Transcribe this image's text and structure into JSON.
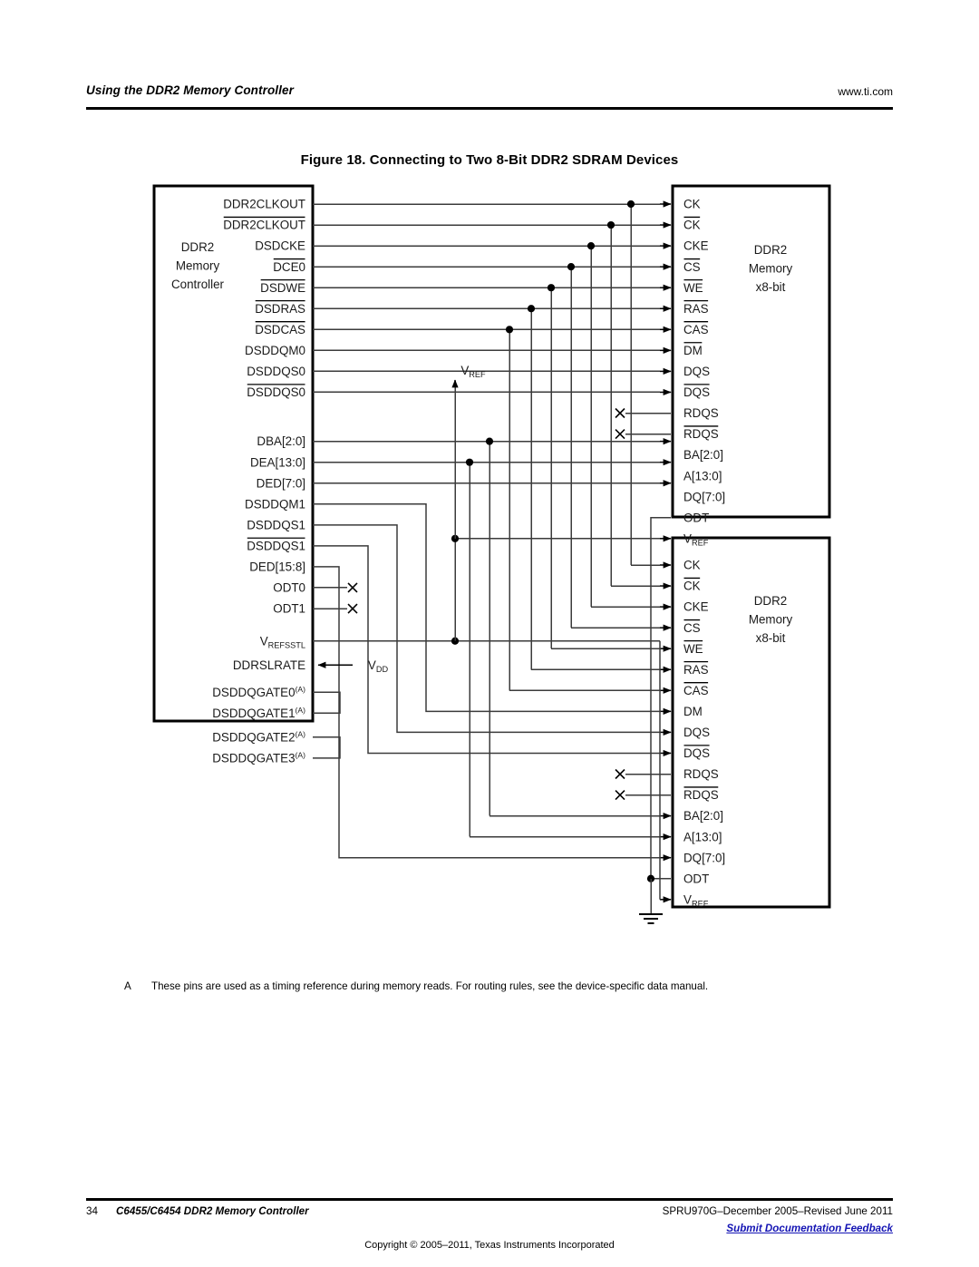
{
  "header": {
    "left_title": "Using the DDR2 Memory Controller",
    "url": "www.ti.com"
  },
  "figure": {
    "title": "Figure 18. Connecting to Two 8-Bit DDR2 SDRAM Devices"
  },
  "diagram": {
    "controller": {
      "name_line1": "DDR2",
      "name_line2": "Memory",
      "name_line3": "Controller",
      "pins": [
        {
          "label": "DDR2CLKOUT",
          "overbar": false
        },
        {
          "label": "DDR2CLKOUT",
          "overbar": true
        },
        {
          "label": "DSDCKE",
          "overbar": false
        },
        {
          "label": "DCE0",
          "overbar": true
        },
        {
          "label": "DSDWE",
          "overbar": true
        },
        {
          "label": "DSDRAS",
          "overbar": true
        },
        {
          "label": "DSDCAS",
          "overbar": true
        },
        {
          "label": "DSDDQM0",
          "overbar": false
        },
        {
          "label": "DSDDQS0",
          "overbar": false
        },
        {
          "label": "DSDDQS0",
          "overbar": true
        },
        {
          "label": "DBA[2:0]",
          "overbar": false
        },
        {
          "label": "DEA[13:0]",
          "overbar": false
        },
        {
          "label": "DED[7:0]",
          "overbar": false
        },
        {
          "label": "DSDDQM1",
          "overbar": false
        },
        {
          "label": "DSDDQS1",
          "overbar": false
        },
        {
          "label": "DSDDQS1",
          "overbar": true
        },
        {
          "label": "DED[15:8]",
          "overbar": false
        },
        {
          "label": "ODT0",
          "overbar": false
        },
        {
          "label": "ODT1",
          "overbar": false
        },
        {
          "label": "VREFSSTL",
          "overbar": false
        },
        {
          "label": "DDRSLRATE",
          "overbar": false
        },
        {
          "label": "DSDDQGATE0",
          "overbar": false
        },
        {
          "label": "DSDDQGATE1",
          "overbar": false
        },
        {
          "label": "DSDDQGATE2",
          "overbar": false
        },
        {
          "label": "DSDDQGATE3",
          "overbar": false
        }
      ],
      "vrefsstl_base": "V",
      "vrefsstl_sub": "REFSSTL",
      "gate_footnote": "(A)",
      "vdd_base": "V",
      "vdd_sub": "DD"
    },
    "memory_top": {
      "name_line1": "DDR2",
      "name_line2": "Memory",
      "name_line3": "x8-bit",
      "pins": [
        {
          "label": "CK",
          "overbar": false
        },
        {
          "label": "CK",
          "overbar": true
        },
        {
          "label": "CKE",
          "overbar": false
        },
        {
          "label": "CS",
          "overbar": true
        },
        {
          "label": "WE",
          "overbar": true
        },
        {
          "label": "RAS",
          "overbar": true
        },
        {
          "label": "CAS",
          "overbar": true
        },
        {
          "label": "DM",
          "overbar": true
        },
        {
          "label": "DQS",
          "overbar": false
        },
        {
          "label": "DQS",
          "overbar": true
        },
        {
          "label": "RDQS",
          "overbar": false
        },
        {
          "label": "RDQS",
          "overbar": true
        },
        {
          "label": "BA[2:0]",
          "overbar": false
        },
        {
          "label": "A[13:0]",
          "overbar": false
        },
        {
          "label": "DQ[7:0]",
          "overbar": false
        },
        {
          "label": "ODT",
          "overbar": false
        },
        {
          "label": "VREF",
          "overbar": false
        }
      ]
    },
    "memory_bottom": {
      "name_line1": "DDR2",
      "name_line2": "Memory",
      "name_line3": "x8-bit",
      "pins": [
        {
          "label": "CK",
          "overbar": false
        },
        {
          "label": "CK",
          "overbar": true
        },
        {
          "label": "CKE",
          "overbar": false
        },
        {
          "label": "CS",
          "overbar": true
        },
        {
          "label": "WE",
          "overbar": true
        },
        {
          "label": "RAS",
          "overbar": true
        },
        {
          "label": "CAS",
          "overbar": true
        },
        {
          "label": "DM",
          "overbar": false
        },
        {
          "label": "DQS",
          "overbar": false
        },
        {
          "label": "DQS",
          "overbar": true
        },
        {
          "label": "RDQS",
          "overbar": false
        },
        {
          "label": "RDQS",
          "overbar": true
        },
        {
          "label": "BA[2:0]",
          "overbar": false
        },
        {
          "label": "A[13:0]",
          "overbar": false
        },
        {
          "label": "DQ[7:0]",
          "overbar": false
        },
        {
          "label": "ODT",
          "overbar": false
        },
        {
          "label": "VREF",
          "overbar": false
        }
      ]
    },
    "vref_marker": {
      "base": "V",
      "sub": "REF"
    }
  },
  "footnote": {
    "mark": "A",
    "text": "These pins are used as a timing reference during memory reads. For routing rules, see the device-specific data manual."
  },
  "footer": {
    "page_number": "34",
    "doc_title": "C6455/C6454 DDR2 Memory Controller",
    "doc_id": "SPRU970G–December 2005–Revised June 2011",
    "feedback_link": "Submit Documentation Feedback",
    "copyright": "Copyright © 2005–2011, Texas Instruments Incorporated"
  },
  "colors": {
    "ink": "#000000",
    "wire": "#3b3b3b",
    "link": "#1414b4"
  }
}
